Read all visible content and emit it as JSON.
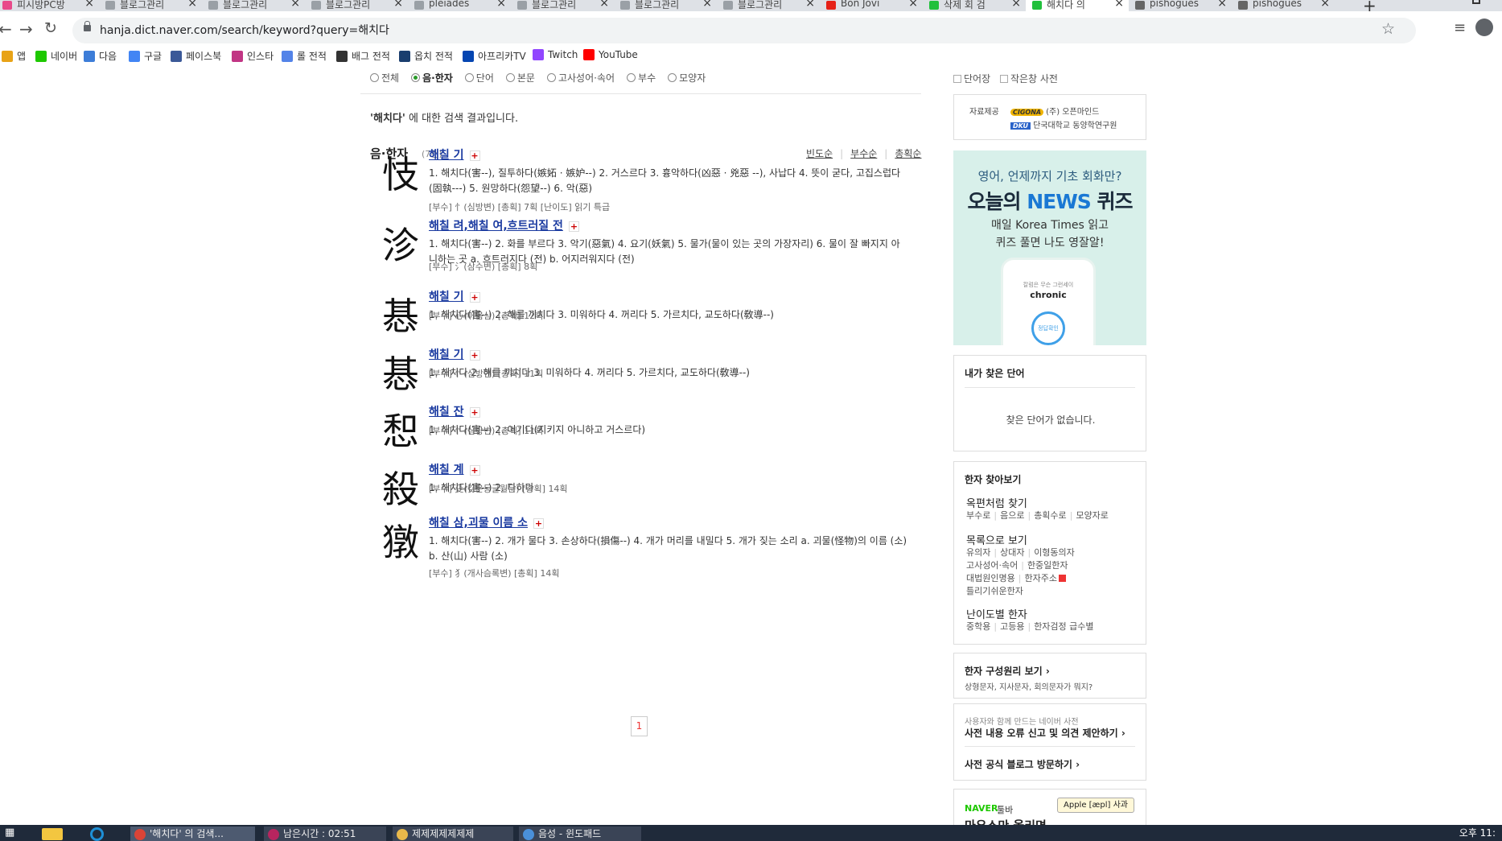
{
  "browser": {
    "tabs": [
      {
        "title": "피시방PC방",
        "color": "#e84a8a"
      },
      {
        "title": "블로그관리",
        "color": "#9aa0a6"
      },
      {
        "title": "블로그관리",
        "color": "#9aa0a6"
      },
      {
        "title": "블로그관리",
        "color": "#9aa0a6"
      },
      {
        "title": "pleiades",
        "color": "#9aa0a6"
      },
      {
        "title": "블로그관리",
        "color": "#9aa0a6"
      },
      {
        "title": "블로그관리",
        "color": "#9aa0a6"
      },
      {
        "title": "블로그관리",
        "color": "#9aa0a6"
      },
      {
        "title": "Bon Jovi",
        "color": "#e62117"
      },
      {
        "title": "삭제 회 검",
        "color": "#21c03c"
      },
      {
        "title": "해치다 의",
        "color": "#21c03c"
      },
      {
        "title": "pishogues",
        "color": "#666666"
      },
      {
        "title": "pishogues",
        "color": "#666666"
      }
    ],
    "active_tab_index": 10,
    "url": "hanja.dict.naver.com/search/keyword?query=해치다",
    "bookmarks": [
      {
        "label": "앱",
        "icon": "apps-icon",
        "color": "#e8a317"
      },
      {
        "label": "네이버",
        "icon": "naver-icon",
        "color": "#1ec800"
      },
      {
        "label": "다음",
        "icon": "daum-icon",
        "color": "#3d7dd8"
      },
      {
        "label": "구글",
        "icon": "google-icon",
        "color": "#4285f4"
      },
      {
        "label": "페이스북",
        "icon": "facebook-icon",
        "color": "#3b5998"
      },
      {
        "label": "인스타",
        "icon": "instagram-icon",
        "color": "#c13584"
      },
      {
        "label": "롤 전적",
        "icon": "op-gg-icon",
        "color": "#5383e8"
      },
      {
        "label": "배그 전적",
        "icon": "pubg-icon",
        "color": "#333333"
      },
      {
        "label": "옵치 전적",
        "icon": "overwatch-icon",
        "color": "#1a3e6e"
      },
      {
        "label": "아프리카TV",
        "icon": "afreecatv-icon",
        "color": "#0545b1"
      },
      {
        "label": "Twitch",
        "icon": "twitch-icon",
        "color": "#9146ff"
      },
      {
        "label": "YouTube",
        "icon": "youtube-icon",
        "color": "#ff0000"
      }
    ]
  },
  "filters": {
    "options": [
      "전체",
      "음·한자",
      "단어",
      "본문",
      "고사성어·속어",
      "부수",
      "모양자"
    ],
    "selected_index": 1
  },
  "result_message": {
    "query": "'해치다'",
    "suffix": " 에 대한 검색 결과입니다."
  },
  "section": {
    "title": "음·한자",
    "count": "(7건)",
    "sorts": [
      "빈도순",
      "부수순",
      "총획순"
    ]
  },
  "entries": [
    {
      "hanja": "忮",
      "reading": "해칠 기",
      "definition": "1. 해치다(害--), 질투하다(嫉妬 · 嫉妒--) 2. 거스르다 3. 흉악하다(凶惡 · 兇惡 --), 사납다 4. 뜻이 굳다, 고집스럽다(固執---) 5. 원망하다(怨望--) 6. 악(惡)",
      "meta": "[부수] 忄(심방변)  [총획] 7획  [난이도] 읽기 특급"
    },
    {
      "hanja": "沴",
      "reading": "해칠 려,해칠 여,흐트러질 전",
      "definition": "1. 해치다(害--) 2. 화를 부르다 3. 악기(惡氣) 4. 요기(妖氣) 5. 물가(물이 있는 곳의 가장자리) 6. 물이 잘 빠지지 아니하는 곳 a. 흐트러지다 (전) b. 어지러워지다 (전)",
      "meta": "[부수] 氵(삼수변)  [총획] 8획"
    },
    {
      "hanja": "惎",
      "reading": "해칠 기",
      "definition": "1. 해치다(害--) 2. 해를 끼치다 3. 미워하다 4. 꺼리다 5. 가르치다, 교도하다(敎導--)",
      "meta": "[부수] 心(마음심)  [총획] 12획"
    },
    {
      "hanja": "惎",
      "reading": "해칠 기",
      "definition": "1. 해치다 2. 해를 끼치다 3. 미워하다 4. 꺼리다 5. 가르치다, 교도하다(敎導--)",
      "meta": "[부수] 忄(심방변)  [총획] 11획"
    },
    {
      "hanja": "惒",
      "reading": "해칠 잔",
      "definition": "1. 해치다(害--) 2. 어기다(지키지 아니하고 거스르다)",
      "meta": "[부수] 忄(심방변)  [총획] 11획"
    },
    {
      "hanja": "殺",
      "reading": "해칠 계",
      "definition": "1. 해치다(害--) 2. 다하다",
      "meta": "[부수] 殳(갖은등글월문)  [총획] 14획"
    },
    {
      "hanja": "獤",
      "reading": "해칠 삼,괴물 이름 소",
      "definition": "1. 해치다(害--) 2. 개가 물다 3. 손상하다(損傷--) 4. 개가 머리를 내밀다 5. 개가 짖는 소리 a. 괴물(怪物)의 이름 (소) b. 산(山) 사람 (소)",
      "meta": "[부수] 犭(개사슴록변)  [총획] 14획"
    }
  ],
  "pagination": {
    "current": "1"
  },
  "sidebar": {
    "options": [
      "단어장",
      "작은창 사전"
    ],
    "provider": {
      "label": "자료제공",
      "line1_badge": "CIGONA",
      "line1": "(주) 오픈마인드",
      "line2_badge": "DKU",
      "line2": "단국대학교 동양학연구원"
    },
    "ad": {
      "line1": "영어, 언제까지 기초 회화만?",
      "line2_pre": "오늘의 ",
      "line2_accent": "NEWS",
      "line2_post": " 퀴즈",
      "line3": "매일 Korea Times 읽고",
      "line4": "퀴즈 풀면 나도 영잘알!",
      "phone_small": "칼럼은 무슨 그런세이",
      "phone_word": "chronic",
      "phone_button": "정답확인"
    },
    "my_words": {
      "title": "내가 찾은 단어",
      "empty": "찾은 단어가 없습니다."
    },
    "hanja_search": {
      "title": "한자 찾아보기",
      "group1_title": "옥편처럼 찾기",
      "group1_links": [
        "부수로",
        "음으로",
        "총획수로",
        "모양자로"
      ],
      "group2_title": "목록으로 보기",
      "group2_row1": [
        "유의자",
        "상대자",
        "이형동의자"
      ],
      "group2_row2": [
        "고사성어·속어",
        "한중일한자"
      ],
      "group2_row3": [
        "대법원인명용",
        "한자주소"
      ],
      "group2_row4": [
        "틀리기쉬운한자"
      ],
      "group3_title": "난이도별 한자",
      "group3_links": [
        "중학용",
        "고등용",
        "한자검정 급수별"
      ]
    },
    "principle": {
      "title": "한자 구성원리 보기 ›",
      "subtitle": "상형문자, 지사문자, 회의문자가 뭐지?"
    },
    "feedback": {
      "small": "사용자와 함께 만드는 네이버 사전",
      "link1": "사전 내용 오류 신고 및 의견 제안하기 ›",
      "link2": "사전 공식 블로그 방문하기 ›"
    },
    "toolbar": {
      "brand": "NAVER",
      "brand_suffix": "툴바",
      "title": "마우스만 올리면",
      "pill": "Apple [æpl] 사과"
    }
  },
  "taskbar": {
    "items": [
      {
        "label": "'해치다' 의 검색...",
        "color": "#db4437"
      },
      {
        "label": "남은시간 : 02:51",
        "color": "#b8255f"
      },
      {
        "label": "제제제제제제제",
        "color": "#e8b84a"
      },
      {
        "label": "음성 - 윈도패드",
        "color": "#4a90d9"
      }
    ],
    "clock": "오후 11:"
  }
}
